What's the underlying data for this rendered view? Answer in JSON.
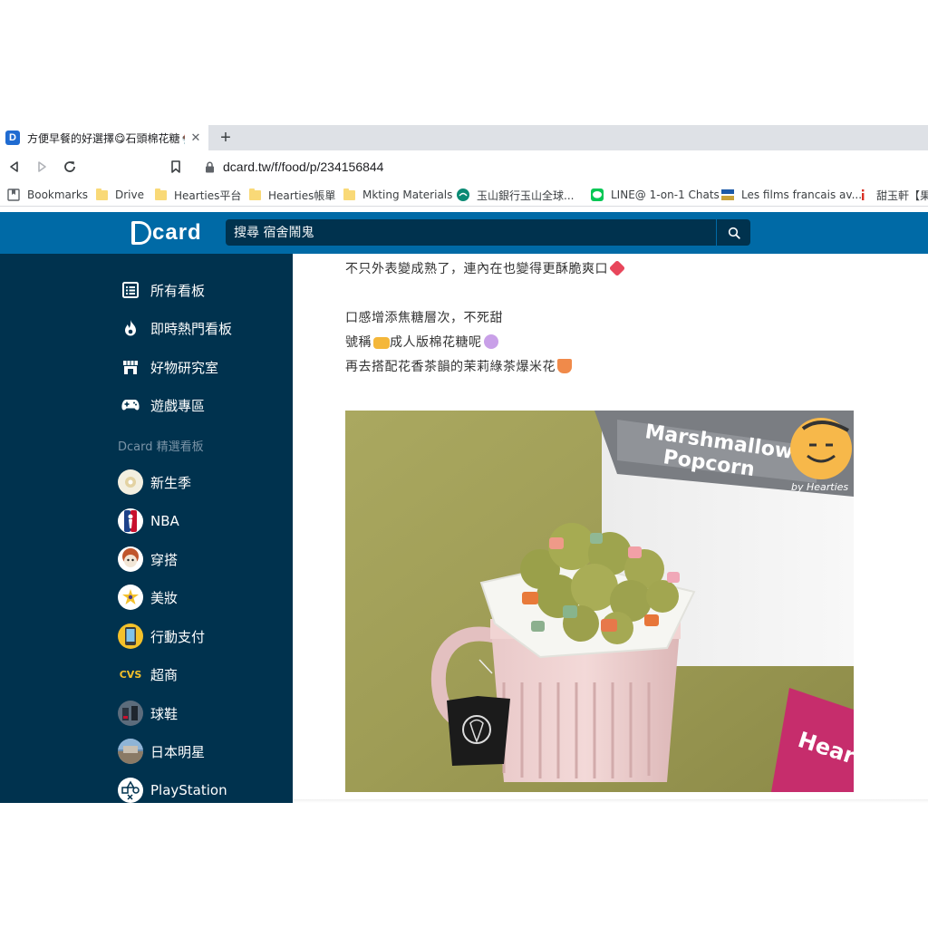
{
  "browser": {
    "tab_title": "方便早餐的好選擇😋石頭棉花糖🍨",
    "tab_close": "✕",
    "new_tab": "+",
    "url": "dcard.tw/f/food/p/234156844",
    "bookmarks": [
      {
        "label": "Bookmarks",
        "icon": "bookmarks-icon"
      },
      {
        "label": "Drive",
        "icon": "folder-icon"
      },
      {
        "label": "Hearties平台",
        "icon": "folder-icon"
      },
      {
        "label": "Hearties帳單",
        "icon": "folder-icon"
      },
      {
        "label": "Mkting Materials",
        "icon": "folder-icon"
      },
      {
        "label": "玉山銀行玉山全球...",
        "icon": "esun-bank-icon"
      },
      {
        "label": "LINE@ 1-on-1 Chats",
        "icon": "line-icon"
      },
      {
        "label": "Les films francais av...",
        "icon": "film-icon"
      },
      {
        "label": "甜玉軒【果露",
        "icon": "info-icon"
      }
    ]
  },
  "header": {
    "logo_text": "card",
    "search_placeholder": "搜尋 宿舍鬧鬼"
  },
  "sidebar": {
    "nav": [
      {
        "label": "所有看板",
        "icon": "list-icon"
      },
      {
        "label": "即時熱門看板",
        "icon": "fire-icon"
      },
      {
        "label": "好物研究室",
        "icon": "store-icon"
      },
      {
        "label": "遊戲專區",
        "icon": "gamepad-icon"
      }
    ],
    "section_title": "Dcard 精選看板",
    "boards": [
      {
        "label": "新生季",
        "avatar_text": "",
        "avatar_bg": "#f3efe0"
      },
      {
        "label": "NBA",
        "avatar_text": "",
        "avatar_bg": "#ffffff"
      },
      {
        "label": "穿搭",
        "avatar_text": "",
        "avatar_bg": "#ffffff"
      },
      {
        "label": "美妝",
        "avatar_text": "",
        "avatar_bg": "#ffffff"
      },
      {
        "label": "行動支付",
        "avatar_text": "",
        "avatar_bg": "#f4c12a"
      },
      {
        "label": "超商",
        "avatar_text": "CVS",
        "avatar_bg": "#00324e"
      },
      {
        "label": "球鞋",
        "avatar_text": "",
        "avatar_bg": "#5c6c7c"
      },
      {
        "label": "日本明星",
        "avatar_text": "",
        "avatar_bg": "#6d8fb0"
      },
      {
        "label": "PlayStation",
        "avatar_text": "",
        "avatar_bg": "#ffffff"
      }
    ]
  },
  "post": {
    "lines": [
      "不只外表變成熟了，連內在也變得更酥脆爽口",
      "口感增添焦糖層次，不死甜",
      "號稱",
      "成人版棉花糖呢",
      "再去搭配花香茶韻的茉莉綠茶爆米花"
    ],
    "image": {
      "bag_text_1": "Marshmallow",
      "bag_text_2": "Popcorn",
      "bag_brand": "by Hearties",
      "pouch_text": "Hear"
    }
  },
  "colors": {
    "brand_blue": "#006aa6",
    "sidebar_navy": "#00324e",
    "search_bg": "#00324e"
  }
}
